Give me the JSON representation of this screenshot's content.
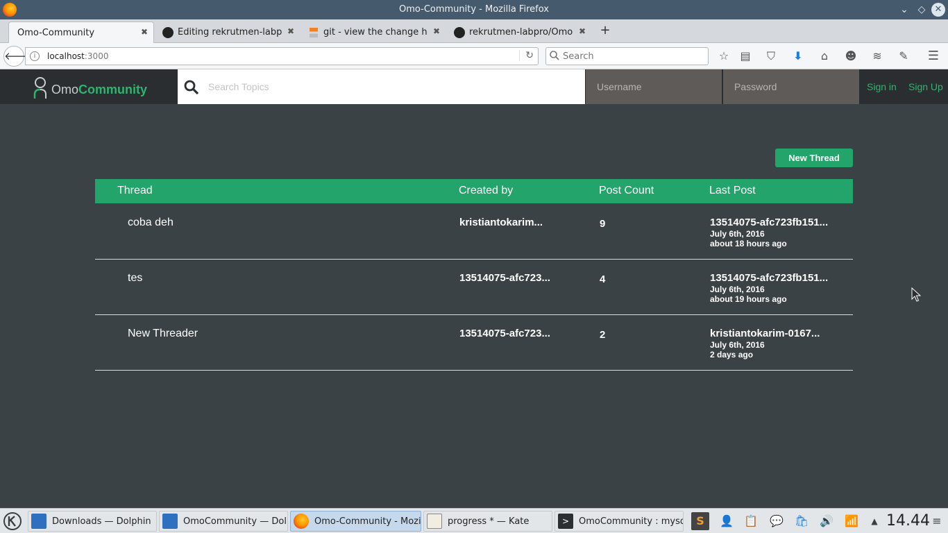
{
  "window": {
    "title": "Omo-Community - Mozilla Firefox"
  },
  "tabs": [
    {
      "label": "Omo-Community",
      "icon": "none"
    },
    {
      "label": "Editing rekrutmen-labp...",
      "icon": "github-icon"
    },
    {
      "label": "git - view the change hi...",
      "icon": "stackoverflow-icon"
    },
    {
      "label": "rekrutmen-labpro/Omo...",
      "icon": "github-icon"
    }
  ],
  "navbar": {
    "url_host": "localhost",
    "url_port": ":3000",
    "search_placeholder": "Search"
  },
  "site": {
    "logo_omo": "Omo",
    "logo_community": "Community",
    "search_placeholder": "Search Topics",
    "username_placeholder": "Username",
    "password_placeholder": "Password",
    "sign_in": "Sign in",
    "sign_up": "Sign Up",
    "new_thread": "New Thread",
    "colors": {
      "accent": "#22a46a",
      "background": "#3b4245",
      "header": "#2a2e30"
    }
  },
  "table": {
    "headers": {
      "thread": "Thread",
      "created_by": "Created by",
      "post_count": "Post Count",
      "last_post": "Last Post"
    },
    "rows": [
      {
        "thread": "coba deh",
        "created_by": "kristiantokarim...",
        "post_count": "9",
        "last_post_user": "13514075-afc723fb151...",
        "last_post_date": "July 6th, 2016",
        "last_post_ago": "about 18 hours ago"
      },
      {
        "thread": "tes",
        "created_by": "13514075-afc723...",
        "post_count": "4",
        "last_post_user": "13514075-afc723fb151...",
        "last_post_date": "July 6th, 2016",
        "last_post_ago": "about 19 hours ago"
      },
      {
        "thread": "New Threader",
        "created_by": "13514075-afc723...",
        "post_count": "2",
        "last_post_user": "kristiantokarim-0167...",
        "last_post_date": "July 6th, 2016",
        "last_post_ago": "2 days ago"
      }
    ]
  },
  "taskbar": {
    "tasks": [
      {
        "label": "Downloads — Dolphin",
        "icon": "dolphin-icon"
      },
      {
        "label": "OmoCommunity — Dolp",
        "icon": "dolphin-icon"
      },
      {
        "label": "Omo-Community - Mozi",
        "icon": "firefox-icon"
      },
      {
        "label": "progress * — Kate",
        "icon": "kate-icon"
      },
      {
        "label": "OmoCommunity : mysql",
        "icon": "terminal-icon"
      }
    ],
    "clock": "14.44"
  }
}
